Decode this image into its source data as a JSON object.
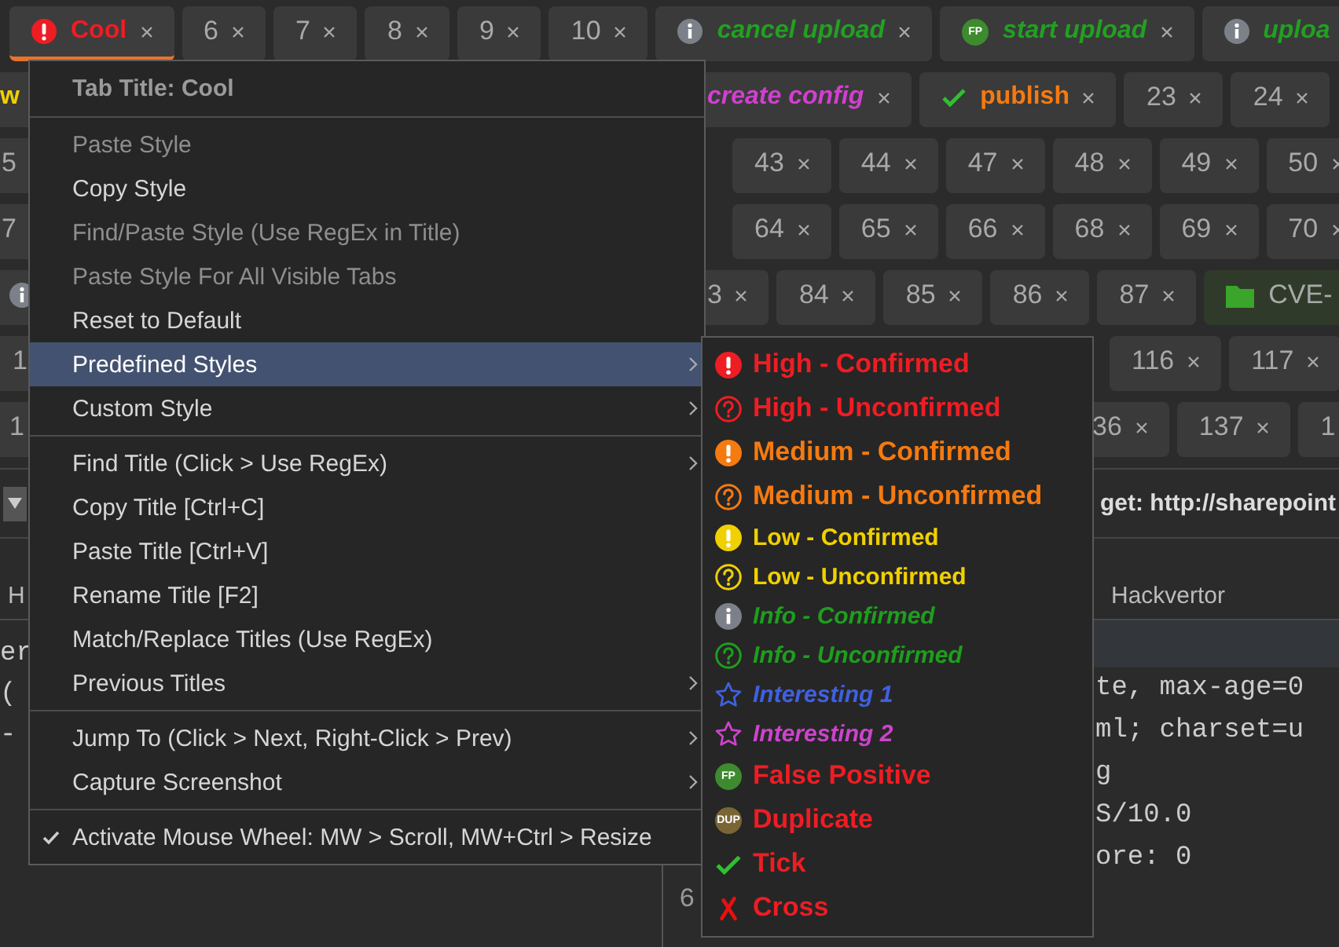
{
  "tab_rows": [
    {
      "left": [
        {
          "label": "Cool",
          "selected": true,
          "bold": true,
          "italic": false,
          "color": "#ee1d23",
          "kind": "exclaim"
        },
        {
          "label": "6",
          "selected": false,
          "bold": false,
          "italic": false
        },
        {
          "label": "7",
          "selected": false,
          "bold": false,
          "italic": false
        },
        {
          "label": "8",
          "selected": false,
          "bold": false,
          "italic": false
        },
        {
          "label": "9",
          "selected": false,
          "bold": false,
          "italic": false
        },
        {
          "label": "10",
          "selected": false,
          "bold": false,
          "italic": false
        },
        {
          "label": "cancel upload",
          "selected": false,
          "bold": true,
          "italic": true,
          "color": "#22a022",
          "kind": "info"
        },
        {
          "label": "start upload",
          "selected": false,
          "bold": true,
          "italic": true,
          "color": "#22a022",
          "kind": "fp",
          "badge": "FP"
        },
        {
          "label": "uploa",
          "selected": false,
          "bold": true,
          "italic": true,
          "color": "#22a022",
          "kind": "info"
        }
      ]
    },
    {
      "left": [
        {
          "label": "w",
          "selected": false,
          "bold": true,
          "italic": false,
          "color": "#f0d000"
        }
      ],
      "right": [
        {
          "label": "create config",
          "selected": false,
          "bold": true,
          "italic": true,
          "color": "#d040d0"
        },
        {
          "label": "publish",
          "selected": false,
          "bold": true,
          "italic": false,
          "color": "#f57a10",
          "kind": "tick"
        },
        {
          "label": "23",
          "selected": false,
          "bold": false,
          "italic": false
        },
        {
          "label": "24",
          "selected": false,
          "bold": false,
          "italic": false
        }
      ]
    },
    {
      "left": [
        {
          "label": "5",
          "selected": false,
          "bold": false,
          "italic": false
        }
      ],
      "right": [
        {
          "label": "43",
          "selected": false,
          "bold": false,
          "italic": false
        },
        {
          "label": "44",
          "selected": false,
          "bold": false,
          "italic": false
        },
        {
          "label": "47",
          "selected": false,
          "bold": false,
          "italic": false
        },
        {
          "label": "48",
          "selected": false,
          "bold": false,
          "italic": false
        },
        {
          "label": "49",
          "selected": false,
          "bold": false,
          "italic": false
        },
        {
          "label": "50",
          "selected": false,
          "bold": false,
          "italic": false
        }
      ]
    },
    {
      "left": [
        {
          "label": "7",
          "selected": false,
          "bold": false,
          "italic": false
        }
      ],
      "right": [
        {
          "label": "64",
          "selected": false,
          "bold": false,
          "italic": false
        },
        {
          "label": "65",
          "selected": false,
          "bold": false,
          "italic": false
        },
        {
          "label": "66",
          "selected": false,
          "bold": false,
          "italic": false
        },
        {
          "label": "68",
          "selected": false,
          "bold": false,
          "italic": false
        },
        {
          "label": "69",
          "selected": false,
          "bold": false,
          "italic": false
        },
        {
          "label": "70",
          "selected": false,
          "bold": false,
          "italic": false
        }
      ]
    },
    {
      "left": [
        {
          "selected": false,
          "kind": "info"
        }
      ],
      "right": [
        {
          "label": "3",
          "selected": false,
          "bold": false,
          "italic": false
        },
        {
          "label": "84",
          "selected": false,
          "bold": false,
          "italic": false
        },
        {
          "label": "85",
          "selected": false,
          "bold": false,
          "italic": false
        },
        {
          "label": "86",
          "selected": false,
          "bold": false,
          "italic": false
        },
        {
          "label": "87",
          "selected": false,
          "bold": false,
          "italic": false
        },
        {
          "label": "CVE-",
          "selected": false,
          "bold": false,
          "italic": false,
          "kind": "folder"
        }
      ]
    },
    {
      "left": [
        {
          "label": "1",
          "selected": false,
          "bold": false,
          "italic": false
        }
      ],
      "right": [
        {
          "label": "116",
          "selected": false,
          "bold": false,
          "italic": false
        },
        {
          "label": "117",
          "selected": false,
          "bold": false,
          "italic": false
        }
      ]
    },
    {
      "left": [
        {
          "label": "1",
          "selected": false,
          "bold": false,
          "italic": false
        }
      ],
      "right": [
        {
          "label": "36",
          "selected": false,
          "bold": false,
          "italic": false
        },
        {
          "label": "137",
          "selected": false,
          "bold": false,
          "italic": false
        },
        {
          "label": "1",
          "selected": false,
          "bold": false,
          "italic": false
        }
      ]
    }
  ],
  "target": "get: http://sharepoint",
  "editor_tabs": {
    "left": "H",
    "right": "Hackvertor"
  },
  "left_text": [
    "er",
    "(",
    "-"
  ],
  "code_lines": [
    {
      "text": "te, max-age=0"
    },
    {
      "text": "ml; charset=u"
    },
    {
      "text": "g"
    },
    {
      "text": "S/10.0"
    },
    {
      "text": "ore: 0"
    },
    {
      "number": "6"
    }
  ],
  "menu": {
    "title": "Tab Title: Cool",
    "groups": [
      {
        "items": [
          {
            "label": "Paste Style",
            "disabled": true,
            "selected": false,
            "checked": false,
            "has_submenu": false
          },
          {
            "label": "Copy Style",
            "disabled": false,
            "selected": false,
            "checked": false,
            "has_submenu": false
          },
          {
            "label": "Find/Paste Style (Use RegEx in Title)",
            "disabled": true,
            "selected": false,
            "checked": false,
            "has_submenu": false
          },
          {
            "label": "Paste Style For All Visible Tabs",
            "disabled": true,
            "selected": false,
            "checked": false,
            "has_submenu": false
          },
          {
            "label": "Reset to Default",
            "disabled": false,
            "selected": false,
            "checked": false,
            "has_submenu": false
          },
          {
            "label": "Predefined Styles",
            "disabled": false,
            "selected": true,
            "checked": false,
            "has_submenu": true
          },
          {
            "label": "Custom Style",
            "disabled": false,
            "selected": false,
            "checked": false,
            "has_submenu": true
          }
        ]
      },
      {
        "items": [
          {
            "label": "Find Title (Click > Use RegEx)",
            "disabled": false,
            "selected": false,
            "checked": false,
            "has_submenu": true
          },
          {
            "label": "Copy Title [Ctrl+C]",
            "disabled": false,
            "selected": false,
            "checked": false,
            "has_submenu": false
          },
          {
            "label": "Paste Title [Ctrl+V]",
            "disabled": false,
            "selected": false,
            "checked": false,
            "has_submenu": false
          },
          {
            "label": "Rename Title [F2]",
            "disabled": false,
            "selected": false,
            "checked": false,
            "has_submenu": false
          },
          {
            "label": "Match/Replace Titles (Use RegEx)",
            "disabled": false,
            "selected": false,
            "checked": false,
            "has_submenu": false
          },
          {
            "label": "Previous Titles",
            "disabled": false,
            "selected": false,
            "checked": false,
            "has_submenu": true
          }
        ]
      },
      {
        "items": [
          {
            "label": "Jump To (Click > Next, Right-Click > Prev)",
            "disabled": false,
            "selected": false,
            "checked": false,
            "has_submenu": true
          },
          {
            "label": "Capture Screenshot",
            "disabled": false,
            "selected": false,
            "checked": false,
            "has_submenu": true
          }
        ]
      },
      {
        "items": [
          {
            "label": "Activate Mouse Wheel: MW > Scroll, MW+Ctrl > Resize",
            "disabled": false,
            "selected": false,
            "checked": true,
            "has_submenu": false
          }
        ]
      }
    ]
  },
  "submenu": [
    {
      "label": "High - Confirmed",
      "kind": "exclaim",
      "color": "#ee1d23",
      "italic": false,
      "large": true
    },
    {
      "label": "High - Unconfirmed",
      "kind": "question",
      "color": "#ee1d23",
      "italic": false,
      "large": true
    },
    {
      "label": "Medium - Confirmed",
      "kind": "exclaim",
      "color": "#f57a10",
      "italic": false,
      "large": true
    },
    {
      "label": "Medium - Unconfirmed",
      "kind": "question",
      "color": "#f57a10",
      "italic": false,
      "large": true
    },
    {
      "label": "Low - Confirmed",
      "kind": "exclaim",
      "color": "#f0d000",
      "italic": false,
      "large": false
    },
    {
      "label": "Low - Unconfirmed",
      "kind": "question",
      "color": "#f0d000",
      "italic": false,
      "large": false
    },
    {
      "label": "Info - Confirmed",
      "kind": "info",
      "color": "#1e9e1e",
      "italic": true,
      "large": false
    },
    {
      "label": "Info - Unconfirmed",
      "kind": "question",
      "color": "#1e9e1e",
      "italic": true,
      "large": false
    },
    {
      "label": "Interesting 1",
      "kind": "star",
      "color": "#4060e0",
      "italic": true,
      "large": false
    },
    {
      "label": "Interesting 2",
      "kind": "star",
      "color": "#cc44cc",
      "italic": true,
      "large": false
    },
    {
      "label": "False Positive",
      "kind": "fp",
      "badge": "FP",
      "color": "#ee1d23",
      "italic": false,
      "large": true
    },
    {
      "label": "Duplicate",
      "kind": "dup",
      "badge": "DUP",
      "color": "#ee1d23",
      "italic": false,
      "large": true
    },
    {
      "label": "Tick",
      "kind": "tick",
      "color": "#ee1d23",
      "italic": false,
      "large": true
    },
    {
      "label": "Cross",
      "kind": "cross",
      "color": "#ee1d23",
      "italic": false,
      "large": true
    }
  ]
}
